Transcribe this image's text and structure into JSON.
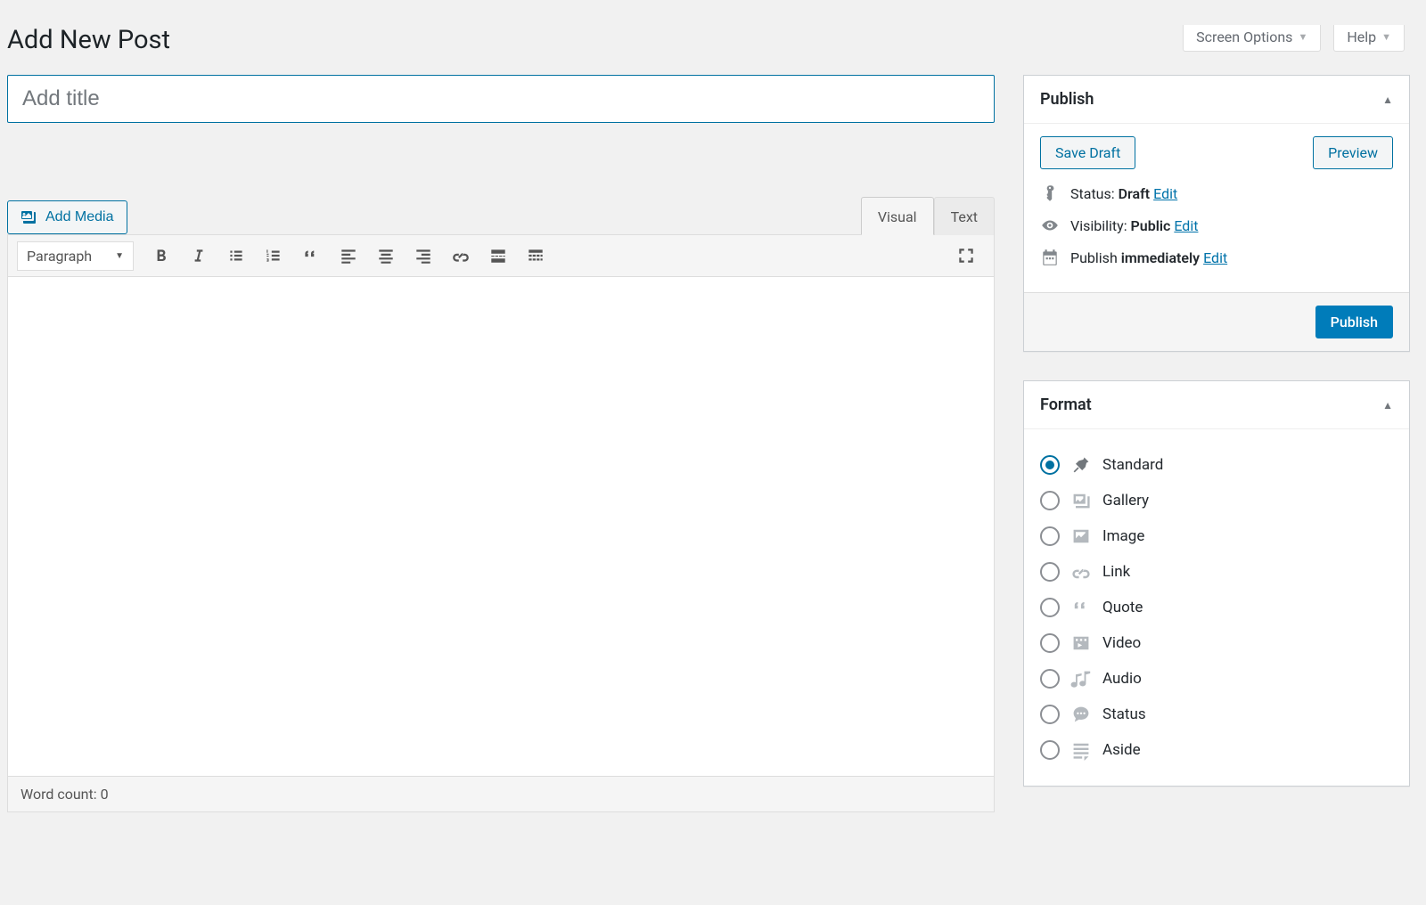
{
  "topbar": {
    "screen_options_label": "Screen Options",
    "help_label": "Help"
  },
  "page": {
    "heading": "Add New Post",
    "title_placeholder": "Add title"
  },
  "media": {
    "add_label": "Add Media"
  },
  "editor": {
    "tabs": {
      "visual": "Visual",
      "text": "Text",
      "active": "visual"
    },
    "paragraph_label": "Paragraph",
    "wordcount_label": "Word count:",
    "wordcount_value": "0"
  },
  "publish_box": {
    "title": "Publish",
    "save_draft_label": "Save Draft",
    "preview_label": "Preview",
    "status_label": "Status:",
    "status_value": "Draft",
    "visibility_label": "Visibility:",
    "visibility_value": "Public",
    "schedule_label": "Publish",
    "schedule_value": "immediately",
    "edit_label": "Edit",
    "publish_button": "Publish"
  },
  "format_box": {
    "title": "Format",
    "selected": "standard",
    "options": [
      {
        "key": "standard",
        "label": "Standard"
      },
      {
        "key": "gallery",
        "label": "Gallery"
      },
      {
        "key": "image",
        "label": "Image"
      },
      {
        "key": "link",
        "label": "Link"
      },
      {
        "key": "quote",
        "label": "Quote"
      },
      {
        "key": "video",
        "label": "Video"
      },
      {
        "key": "audio",
        "label": "Audio"
      },
      {
        "key": "status",
        "label": "Status"
      },
      {
        "key": "aside",
        "label": "Aside"
      }
    ]
  }
}
